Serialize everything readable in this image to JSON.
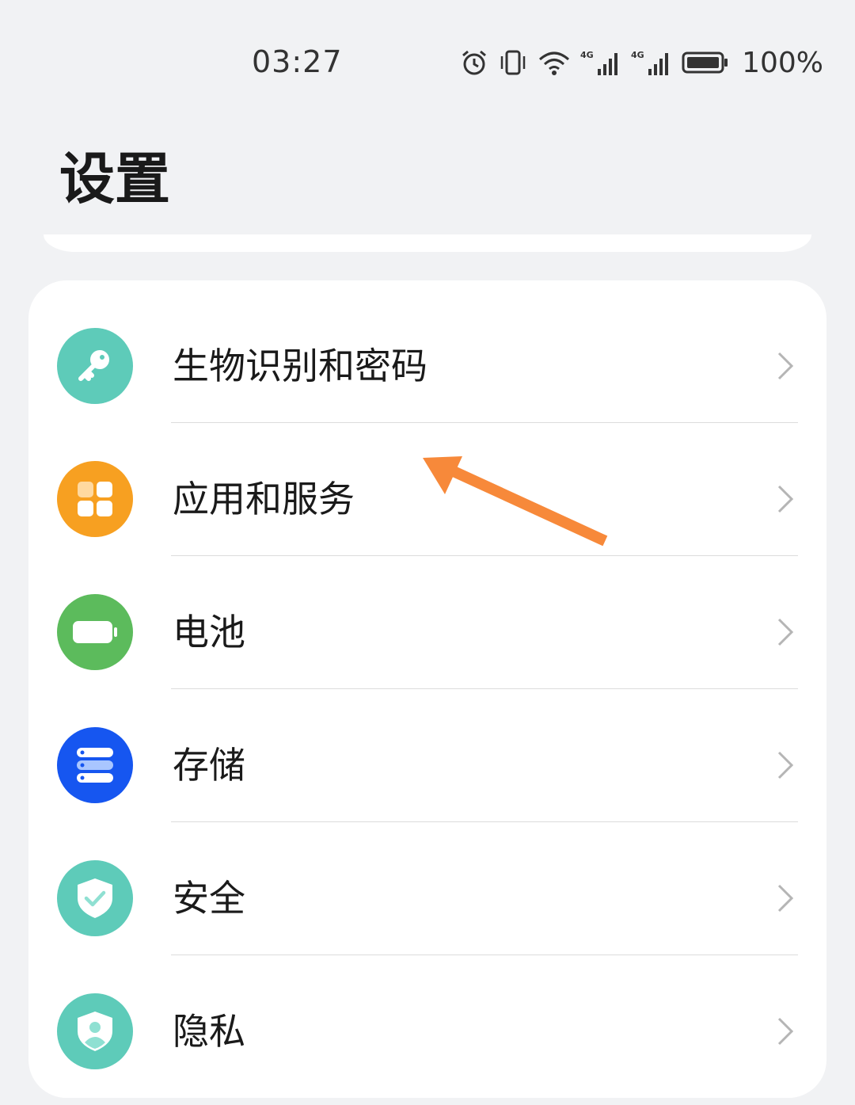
{
  "status_bar": {
    "time": "03:27",
    "battery_percent": "100%",
    "icons": [
      "alarm-icon",
      "vibrate-icon",
      "wifi-icon",
      "signal-4g-icon",
      "signal-4g-icon",
      "battery-icon"
    ]
  },
  "page": {
    "title": "设置"
  },
  "settings": {
    "items": [
      {
        "label": "生物识别和密码",
        "icon": "key-icon",
        "color": "#5ecbb9"
      },
      {
        "label": "应用和服务",
        "icon": "apps-grid-icon",
        "color": "#f7a021"
      },
      {
        "label": "电池",
        "icon": "battery-icon",
        "color": "#5cbb5c"
      },
      {
        "label": "存储",
        "icon": "storage-icon",
        "color": "#1656f0"
      },
      {
        "label": "安全",
        "icon": "shield-check-icon",
        "color": "#5ecbb9"
      },
      {
        "label": "隐私",
        "icon": "privacy-icon",
        "color": "#5ecbb9"
      }
    ]
  },
  "annotation": {
    "arrow_color": "#f7893a"
  }
}
